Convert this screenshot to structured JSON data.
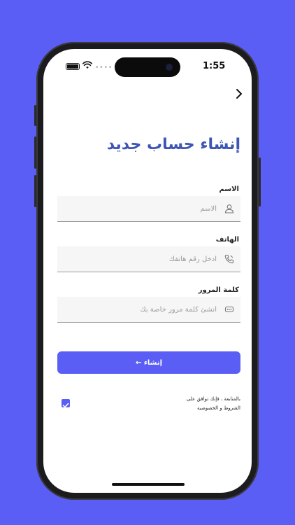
{
  "status": {
    "time": "1:55"
  },
  "page": {
    "title": "إنشاء حساب جديد"
  },
  "form": {
    "name": {
      "label": "الاسم",
      "placeholder": "الاسم",
      "value": ""
    },
    "phone": {
      "label": "الهاتف",
      "placeholder": "ادخل رقم هاتفك",
      "value": ""
    },
    "password": {
      "label": "كلمة المرور",
      "placeholder": "أنشئ كلمة مرور خاصة بك",
      "value": ""
    },
    "submit_label": "إنشاء ←"
  },
  "terms": {
    "line1": "بالمتابعة ، فإنك توافق على",
    "line2": "الشروط و الخصوصية",
    "checked": true
  },
  "colors": {
    "accent": "#5a5ef5",
    "title": "#3d55b4"
  }
}
